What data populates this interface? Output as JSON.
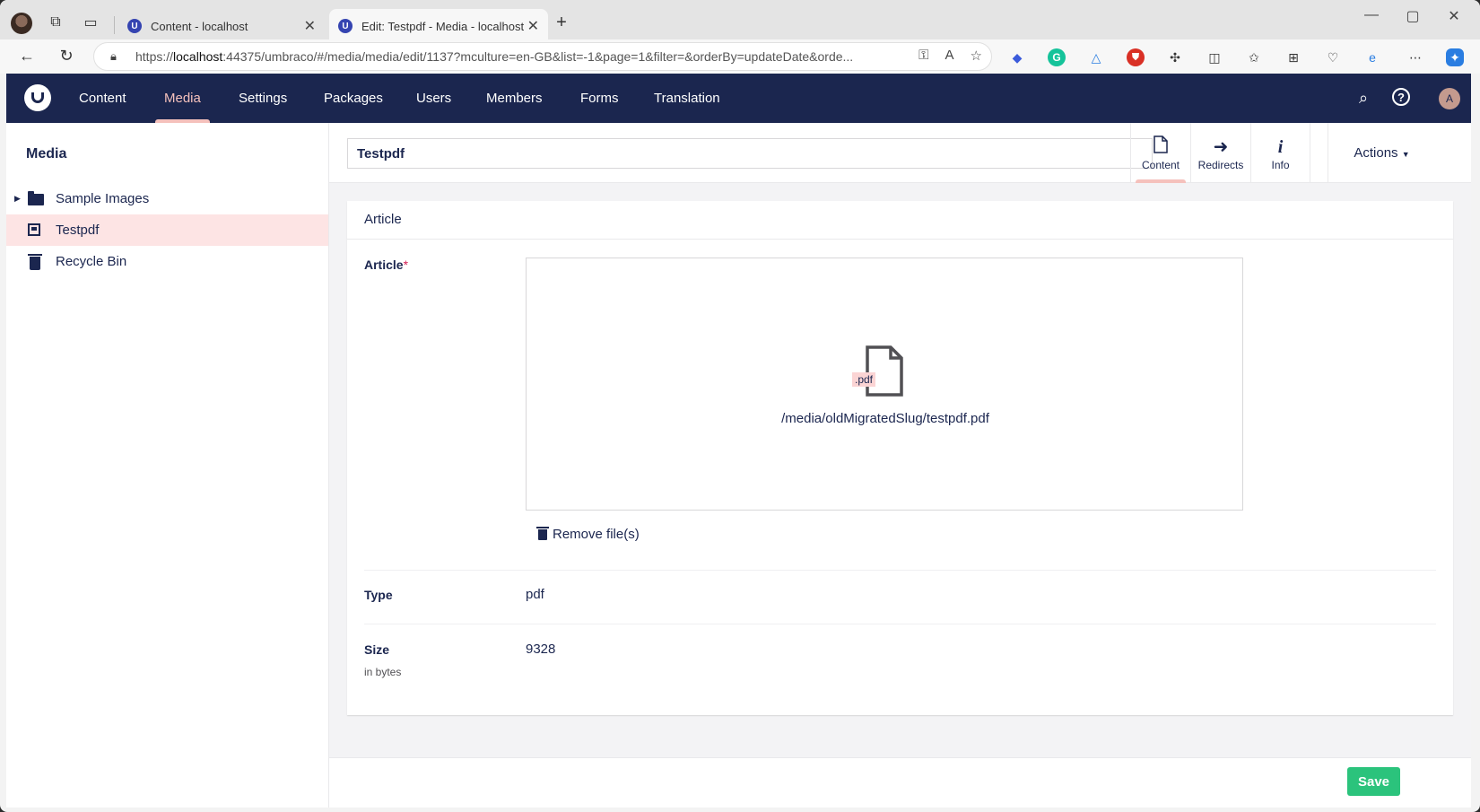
{
  "browser": {
    "tabs": [
      {
        "title": "Content - localhost"
      },
      {
        "title": "Edit: Testpdf - Media - localhost"
      }
    ],
    "url_prefix": "https://",
    "url_host": "localhost",
    "url_rest": ":44375/umbraco/#/media/media/edit/1137?mculture=en-GB&list=-1&page=1&filter=&orderBy=updateDate&orde..."
  },
  "topnav": {
    "items": [
      "Content",
      "Media",
      "Settings",
      "Packages",
      "Users",
      "Members",
      "Forms",
      "Translation"
    ],
    "active": "Media",
    "user_initial": "A"
  },
  "sidebar": {
    "title": "Media",
    "items": [
      {
        "label": "Sample Images",
        "icon": "folder-icon"
      },
      {
        "label": "Testpdf",
        "icon": "media-icon"
      },
      {
        "label": "Recycle Bin",
        "icon": "trash-icon"
      }
    ]
  },
  "editor": {
    "name_value": "Testpdf",
    "apps": [
      {
        "label": "Content",
        "icon": "document-icon"
      },
      {
        "label": "Redirects",
        "icon": "arrow-right-icon"
      },
      {
        "label": "Info",
        "icon": "info-icon"
      }
    ],
    "actions_label": "Actions",
    "group_title": "Article",
    "properties": {
      "article_label": "Article",
      "required_marker": "*",
      "file_ext": ".pdf",
      "file_path": "/media/oldMigratedSlug/testpdf.pdf",
      "remove_label": "Remove file(s)",
      "type_label": "Type",
      "type_value": "pdf",
      "size_label": "Size",
      "size_desc": "in bytes",
      "size_value": "9328"
    },
    "save_label": "Save"
  },
  "colors": {
    "nav_bg": "#1b264f",
    "accent": "#f5c1bc",
    "save": "#2bc37c",
    "selected_bg": "#fde4e4"
  }
}
